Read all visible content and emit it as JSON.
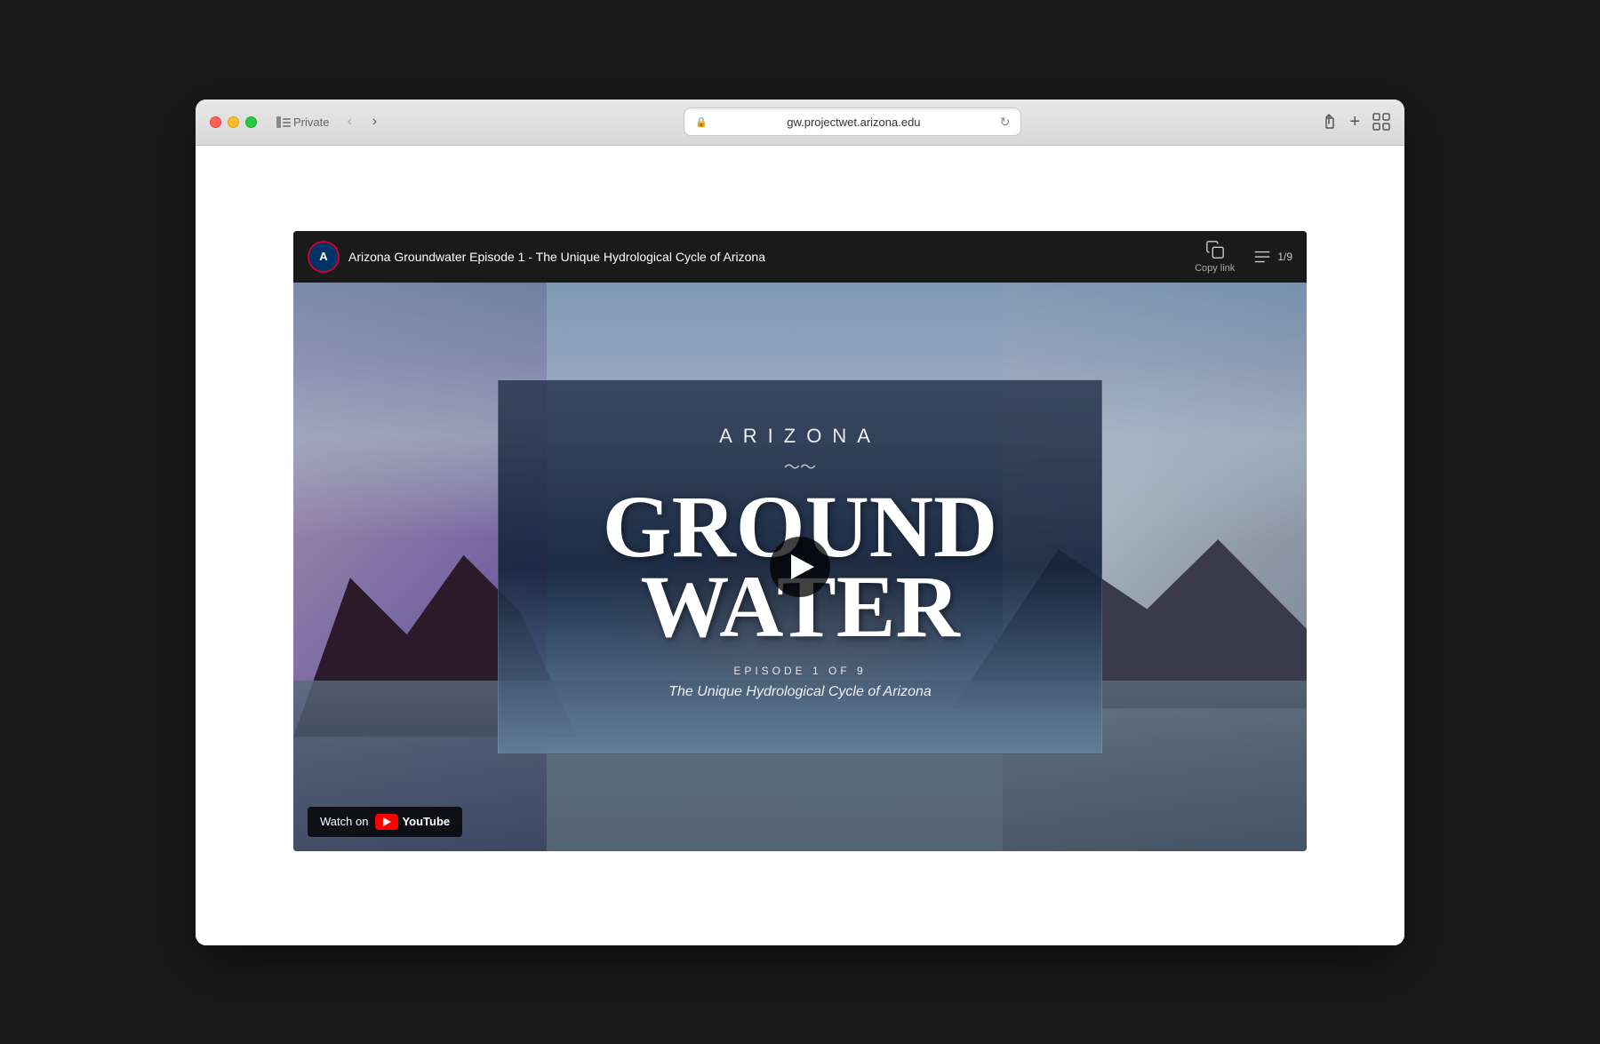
{
  "browser": {
    "traffic_lights": {
      "red": "close",
      "yellow": "minimize",
      "green": "maximize"
    },
    "sidebar_label": "Private",
    "back_button": "‹",
    "forward_button": "›",
    "url": "gw.projectwet.arizona.edu",
    "lock_icon": "🔒",
    "refresh_icon": "↻",
    "share_icon": "↑",
    "new_tab_icon": "+",
    "grid_icon": "⊞"
  },
  "video": {
    "channel_avatar_letter": "A",
    "title": "Arizona Groundwater Episode 1 - The Unique Hydrological Cycle of Arizona",
    "copy_link_label": "Copy link",
    "playlist_count": "1/9",
    "card": {
      "arizona": "ARIZONA",
      "flourish": "〜〜",
      "groundwater_line1": "GROUND",
      "groundwater_line2": "WATER",
      "episode": "EPISODE 1 OF 9",
      "subtitle": "The Unique Hydrological Cycle of Arizona"
    },
    "watch_on_label": "Watch on",
    "youtube_label": "YouTube"
  }
}
